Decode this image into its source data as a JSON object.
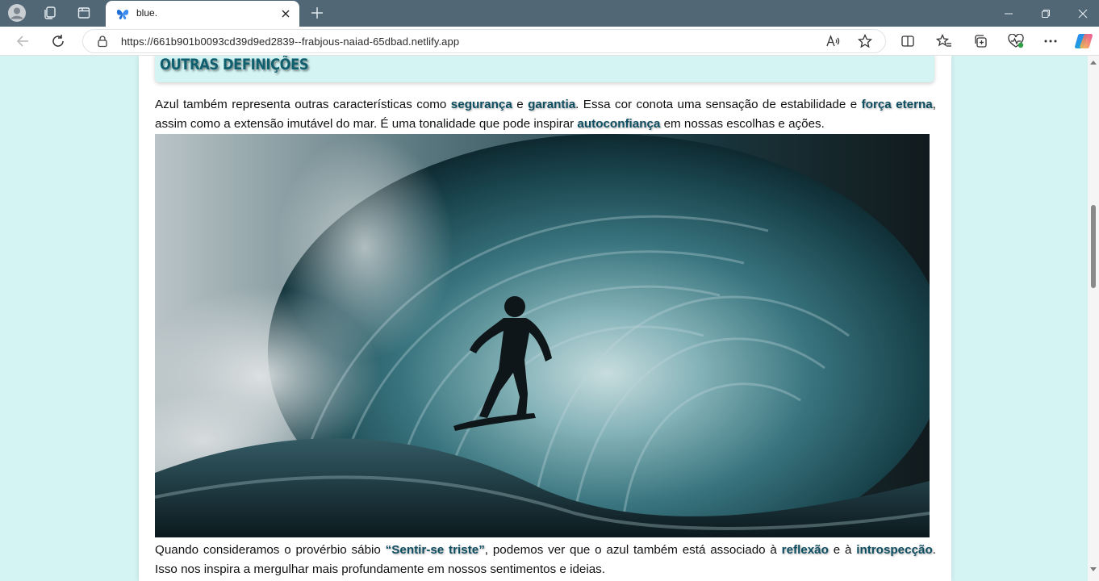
{
  "browser": {
    "tab": {
      "title": "blue.",
      "favicon": "butterfly-icon"
    },
    "address_bar": {
      "url": "https://661b901b0093cd39d9ed2839--frabjous-naiad-65dbad.netlify.app"
    },
    "colors": {
      "titlebar": "#516776",
      "page_background": "#d4f4f4",
      "accent": "#0e4e61"
    }
  },
  "article": {
    "section_heading": "OUTRAS DEFINIÇÕES",
    "paragraph1": {
      "t1": "Azul também representa outras características como ",
      "k1": "segurança",
      "t2": " e ",
      "k2": "garantia",
      "t3": ". Essa cor conota uma sensação de estabilidade e ",
      "k3": "força eterna",
      "t4": ", assim como a extensão imutável do mar. É uma tonalidade que pode inspirar ",
      "k4": "autoconfiança",
      "t5": " em nossas escolhas e ações."
    },
    "image": {
      "subject": "surfer-in-wave-barrel"
    },
    "paragraph2": {
      "t1": "Quando consideramos o provérbio sábio ",
      "k1": "“Sentir-se triste”",
      "t2": ", podemos ver que o azul também está associado à ",
      "k2": "reflexão",
      "t3": " e à ",
      "k3": "introspecção",
      "t4": ". Isso nos inspira a mergulhar mais profundamente em nossos sentimentos e ideias."
    }
  }
}
